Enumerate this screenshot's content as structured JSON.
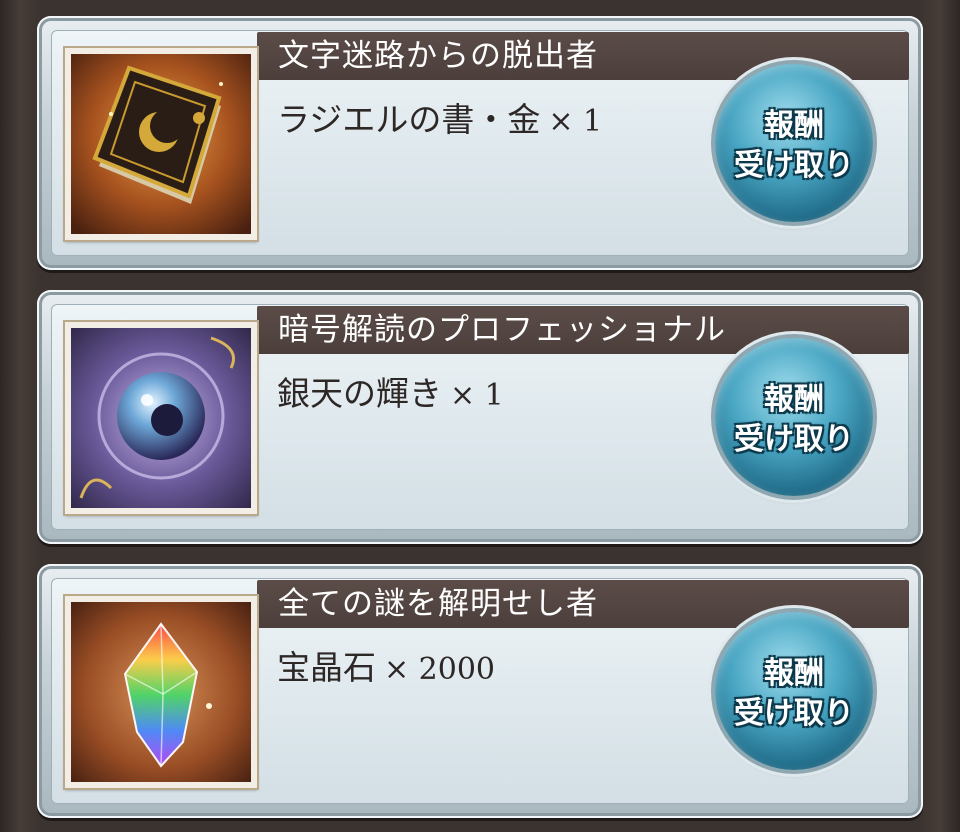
{
  "rewards": [
    {
      "title": "文字迷路からの脱出者",
      "item": "ラジエルの書・金",
      "quantity": "× 1",
      "icon": "gold-book-icon",
      "button_line1": "報酬",
      "button_line2": "受け取り"
    },
    {
      "title": "暗号解読のプロフェッショナル",
      "item": "銀天の輝き",
      "quantity": "× 1",
      "icon": "cosmic-orb-icon",
      "button_line1": "報酬",
      "button_line2": "受け取り"
    },
    {
      "title": "全ての謎を解明せし者",
      "item": "宝晶石",
      "quantity": "× 2000",
      "icon": "rainbow-crystal-icon",
      "button_line1": "報酬",
      "button_line2": "受け取り"
    }
  ],
  "colors": {
    "title_bar": "#4c3f3b",
    "button": "#4aa7c4",
    "panel": "#dde7ec"
  }
}
